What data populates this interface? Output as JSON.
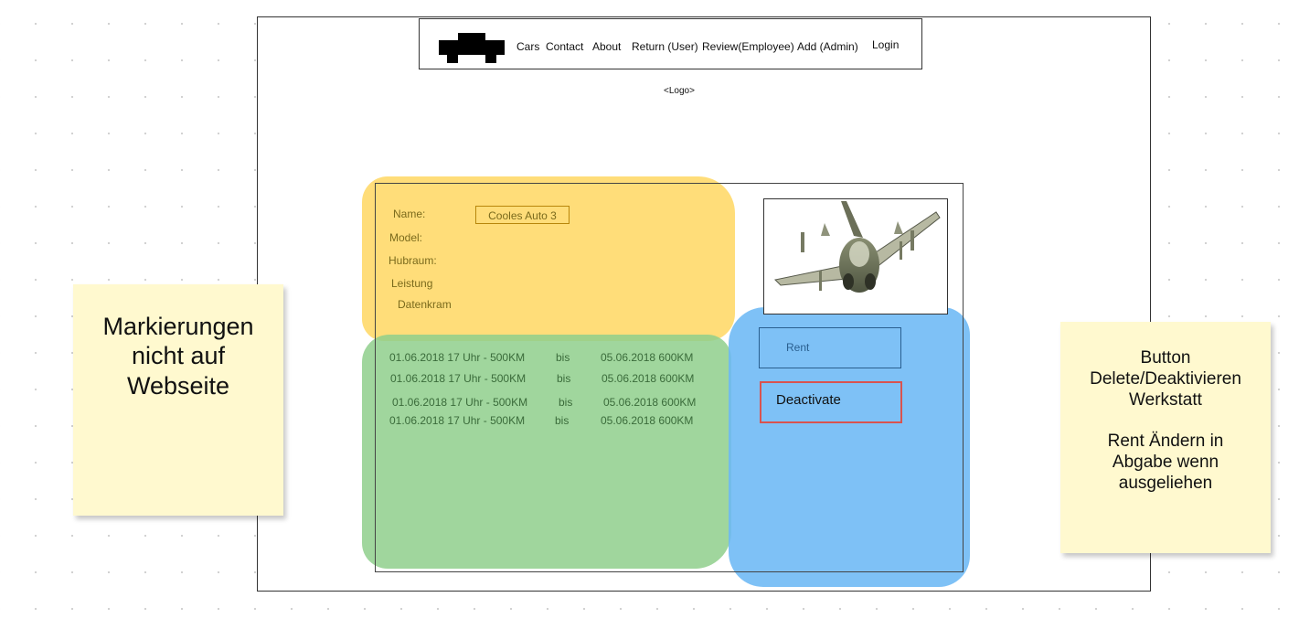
{
  "navbar": {
    "items": [
      "Cars",
      "Contact",
      "About",
      "Return (User)",
      "Review(Employee)",
      "Add (Admin)"
    ],
    "login": "Login"
  },
  "logo_placeholder": "<Logo>",
  "details": {
    "labels": [
      "Name:",
      "Model:",
      "Hubraum:",
      "Leistung",
      "Datenkram"
    ],
    "name_value": "Cooles Auto 3"
  },
  "rentals": [
    {
      "from": "01.06.2018 17 Uhr - 500KM",
      "sep": "bis",
      "to": "05.06.2018 600KM"
    },
    {
      "from": "01.06.2018 17 Uhr - 500KM",
      "sep": "bis",
      "to": "05.06.2018 600KM"
    },
    {
      "from": "01.06.2018 17 Uhr - 500KM",
      "sep": "bis",
      "to": "05.06.2018 600KM"
    },
    {
      "from": "01.06.2018 17 Uhr - 500KM",
      "sep": "bis",
      "to": "05.06.2018 600KM"
    }
  ],
  "buttons": {
    "rent": "Rent",
    "deactivate": "Deactivate"
  },
  "notes": {
    "left": [
      "Markierungen",
      "nicht auf",
      "Webseite"
    ],
    "right": [
      "Button",
      "Delete/Deaktivieren",
      "Werkstatt",
      "",
      "Rent Ändern in",
      "Abgabe wenn",
      "ausgeliehen"
    ]
  },
  "colors": {
    "yellow_marker": "#ffd866",
    "green_marker": "#8fcf8c",
    "blue_marker": "#6cb8f5",
    "deactivate_border": "#d9534f",
    "sticky_note": "#fff9cf"
  },
  "icons": {
    "logo": "car-icon",
    "image": "fighter-jet-image"
  }
}
